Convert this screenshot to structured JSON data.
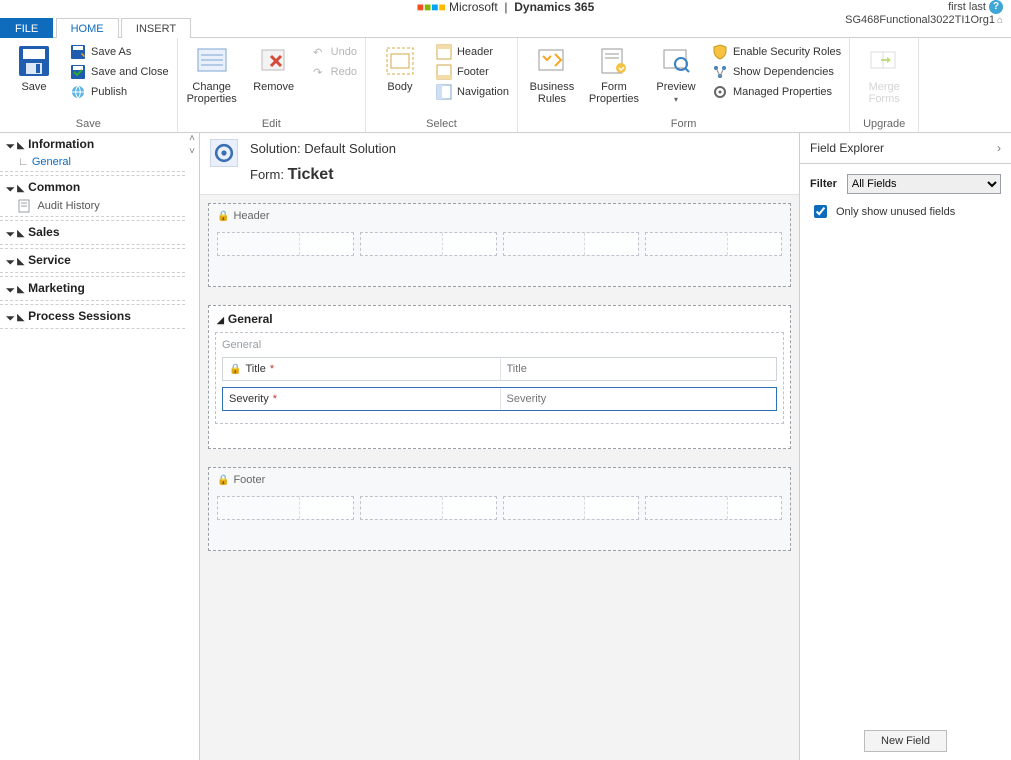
{
  "brand": {
    "company": "Microsoft",
    "sep": "|",
    "product": "Dynamics 365"
  },
  "user": {
    "name": "first last",
    "org": "SG468Functional3022TI1Org1"
  },
  "tabs": {
    "file": "FILE",
    "home": "HOME",
    "insert": "INSERT"
  },
  "ribbon": {
    "save_group": "Save",
    "save": "Save",
    "save_as": "Save As",
    "save_close": "Save and Close",
    "publish": "Publish",
    "edit_group": "Edit",
    "change_props": "Change\nProperties",
    "remove": "Remove",
    "undo": "Undo",
    "redo": "Redo",
    "select_group": "Select",
    "body": "Body",
    "header": "Header",
    "footer": "Footer",
    "navigation": "Navigation",
    "form_group": "Form",
    "biz_rules": "Business\nRules",
    "form_props": "Form\nProperties",
    "preview": "Preview",
    "enable_sec": "Enable Security Roles",
    "show_dep": "Show Dependencies",
    "managed_props": "Managed Properties",
    "upgrade_group": "Upgrade",
    "merge_forms": "Merge\nForms"
  },
  "leftnav": {
    "info": "Information",
    "general": "General",
    "common": "Common",
    "audit": "Audit History",
    "sales": "Sales",
    "service": "Service",
    "marketing": "Marketing",
    "process": "Process Sessions"
  },
  "canvas_head": {
    "solution_label": "Solution:",
    "solution_name": "Default Solution",
    "form_label": "Form:",
    "form_name": "Ticket"
  },
  "form_sections": {
    "header": "Header",
    "footer": "Footer",
    "general": "General",
    "general_sub": "General",
    "title_lbl": "Title",
    "title_ph": "Title",
    "severity_lbl": "Severity",
    "severity_ph": "Severity"
  },
  "rightpanel": {
    "title": "Field Explorer",
    "filter_label": "Filter",
    "filter_value": "All Fields",
    "only_unused": "Only show unused fields",
    "new_field": "New Field"
  }
}
